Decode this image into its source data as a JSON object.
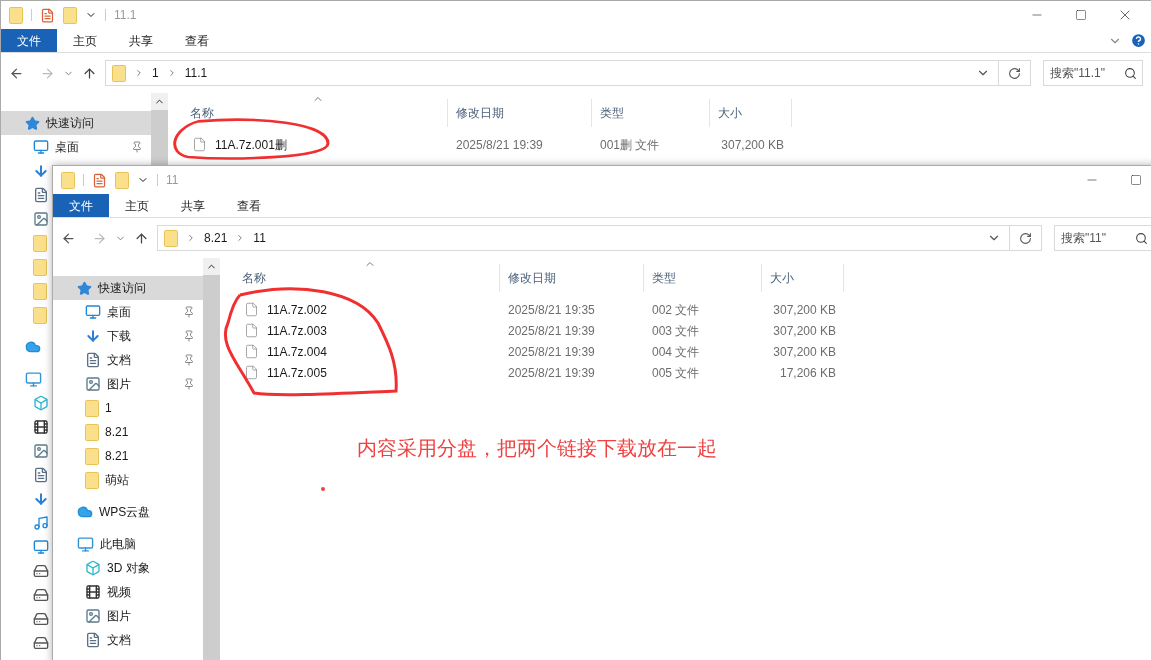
{
  "windows": [
    {
      "title": "11.1",
      "tabs": [
        {
          "label": "文件",
          "selected": true
        },
        {
          "label": "主页",
          "selected": false
        },
        {
          "label": "共享",
          "selected": false
        },
        {
          "label": "查看",
          "selected": false
        }
      ],
      "breadcrumb": [
        "1",
        "11.1"
      ],
      "search": {
        "placeholder": "搜索\"11.1\""
      },
      "nav": [
        {
          "label": "快速访问",
          "kind": "star",
          "selected": true,
          "children": [
            {
              "label": "桌面",
              "kind": "desktop",
              "pinned": true,
              "selected": false
            },
            {
              "kind": "download"
            },
            {
              "kind": "document"
            },
            {
              "kind": "picture"
            },
            {
              "kind": "folder"
            },
            {
              "kind": "folder"
            },
            {
              "kind": "folder"
            },
            {
              "kind": "folder"
            }
          ]
        },
        {
          "kind": "cloud"
        },
        {
          "kind": "computer",
          "children": [
            {
              "kind": "cube"
            },
            {
              "kind": "video"
            },
            {
              "kind": "picture"
            },
            {
              "kind": "document"
            },
            {
              "kind": "download"
            },
            {
              "kind": "music"
            },
            {
              "kind": "desktop"
            },
            {
              "kind": "drive"
            },
            {
              "kind": "drive"
            },
            {
              "kind": "drive"
            },
            {
              "kind": "drive"
            }
          ]
        }
      ],
      "columns": [
        "名称",
        "修改日期",
        "类型",
        "大小"
      ],
      "files": [
        {
          "name": "11A.7z.001删",
          "modified": "2025/8/21 19:39",
          "type": "001删 文件",
          "size": "307,200 KB"
        }
      ]
    },
    {
      "title": "11",
      "tabs": [
        {
          "label": "文件",
          "selected": true
        },
        {
          "label": "主页",
          "selected": false
        },
        {
          "label": "共享",
          "selected": false
        },
        {
          "label": "查看",
          "selected": false
        }
      ],
      "breadcrumb": [
        "8.21",
        "11"
      ],
      "search": {
        "placeholder": "搜索\"11\""
      },
      "nav": [
        {
          "label": "快速访问",
          "kind": "star",
          "selected": true,
          "children": [
            {
              "label": "桌面",
              "kind": "desktop",
              "pinned": true,
              "selected": false
            },
            {
              "label": "下载",
              "kind": "download",
              "pinned": true,
              "selected": false
            },
            {
              "label": "文档",
              "kind": "document",
              "pinned": true,
              "selected": false
            },
            {
              "label": "图片",
              "kind": "picture",
              "pinned": true,
              "selected": false
            },
            {
              "label": "1",
              "kind": "folder",
              "selected": false
            },
            {
              "label": "8.21",
              "kind": "folder",
              "selected": false
            },
            {
              "label": "8.21",
              "kind": "folder",
              "selected": false
            },
            {
              "label": "萌站",
              "kind": "folder",
              "selected": false
            }
          ]
        },
        {
          "label": "WPS云盘",
          "kind": "cloud",
          "selected": false
        },
        {
          "label": "此电脑",
          "kind": "computer",
          "selected": false,
          "children": [
            {
              "label": "3D 对象",
              "kind": "cube",
              "selected": false
            },
            {
              "label": "视频",
              "kind": "video",
              "selected": false
            },
            {
              "label": "图片",
              "kind": "picture",
              "selected": false
            },
            {
              "label": "文档",
              "kind": "document",
              "selected": false
            }
          ]
        }
      ],
      "columns": [
        "名称",
        "修改日期",
        "类型",
        "大小"
      ],
      "files": [
        {
          "name": "11A.7z.002",
          "modified": "2025/8/21 19:35",
          "type": "002 文件",
          "size": "307,200 KB"
        },
        {
          "name": "11A.7z.003",
          "modified": "2025/8/21 19:39",
          "type": "003 文件",
          "size": "307,200 KB"
        },
        {
          "name": "11A.7z.004",
          "modified": "2025/8/21 19:39",
          "type": "004 文件",
          "size": "307,200 KB"
        },
        {
          "name": "11A.7z.005",
          "modified": "2025/8/21 19:39",
          "type": "005 文件",
          "size": "17,206 KB"
        }
      ]
    }
  ],
  "annotation": {
    "text": "内容采用分盘，把两个链接下载放在一起"
  }
}
